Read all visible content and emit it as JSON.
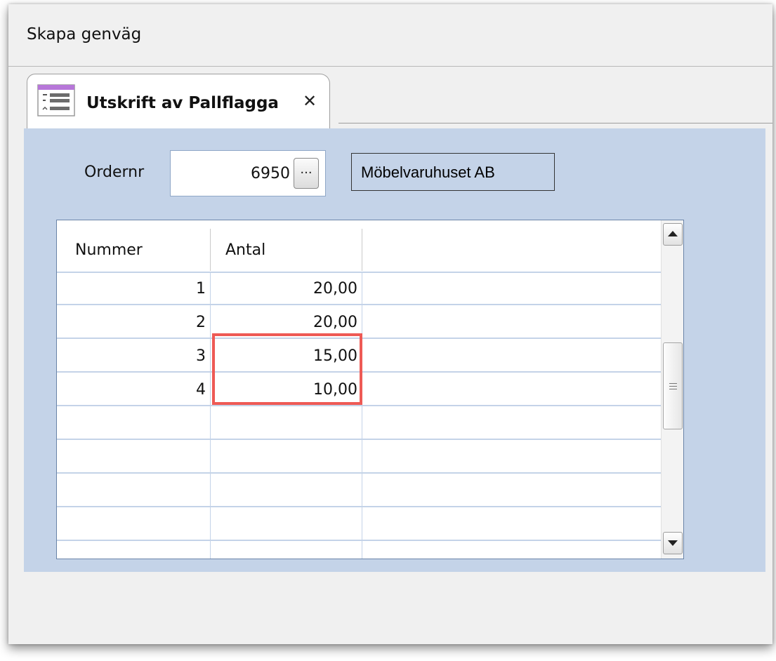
{
  "window": {
    "menu_title": "Skapa genväg"
  },
  "tab": {
    "label": "Utskrift av Pallflagga",
    "close_glyph": "✕",
    "icon": "report-form-icon"
  },
  "form": {
    "ordernr_label": "Ordernr",
    "ordernr_value": "6950",
    "lookup_label": "...",
    "customer_name": "Möbelvaruhuset AB"
  },
  "grid": {
    "columns": [
      "Nummer",
      "Antal",
      ""
    ],
    "rows": [
      {
        "nummer": "1",
        "antal": "20,00"
      },
      {
        "nummer": "2",
        "antal": "20,00"
      },
      {
        "nummer": "3",
        "antal": "15,00"
      },
      {
        "nummer": "4",
        "antal": "10,00"
      },
      {
        "nummer": "",
        "antal": ""
      },
      {
        "nummer": "",
        "antal": ""
      },
      {
        "nummer": "",
        "antal": ""
      },
      {
        "nummer": "",
        "antal": ""
      }
    ]
  },
  "annotation": {
    "highlight_color": "#ee5a55",
    "highlighted_rows": [
      "3",
      "4"
    ]
  },
  "colors": {
    "panel_bg": "#c4d3e8",
    "tab_accent": "#b777d9"
  }
}
